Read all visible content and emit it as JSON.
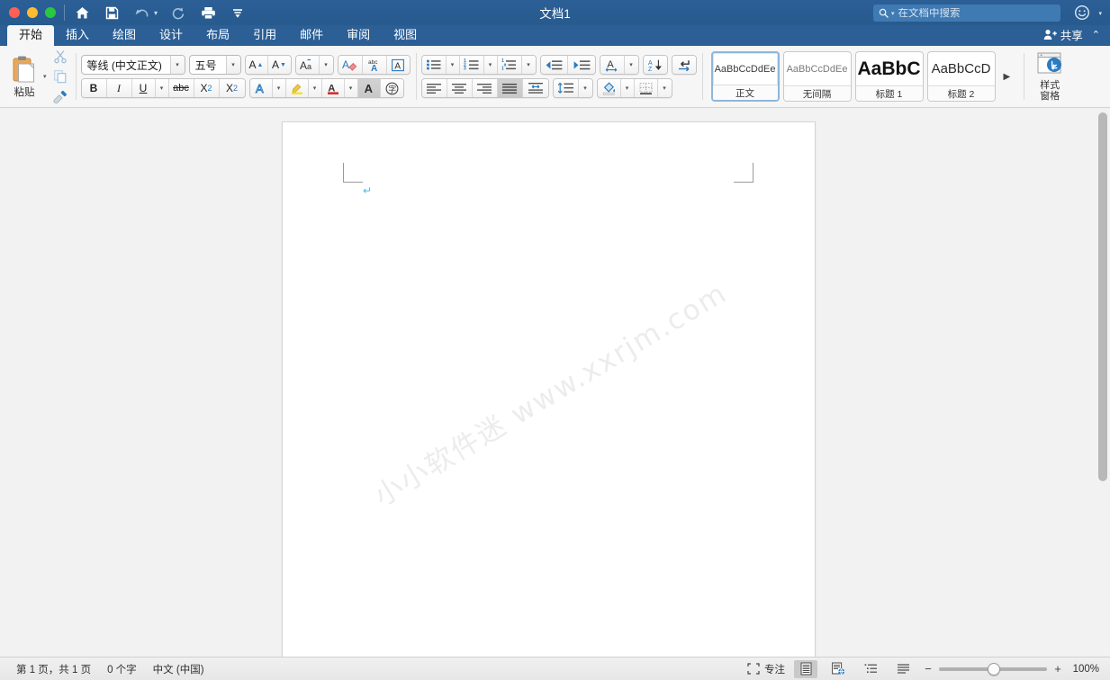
{
  "titlebar": {
    "document_title": "文档1",
    "traffic_lights": [
      "close",
      "minimize",
      "maximize"
    ],
    "quick_access": [
      {
        "name": "home-icon",
        "tooltip": "主页"
      },
      {
        "name": "save-icon",
        "tooltip": "保存"
      },
      {
        "name": "undo-icon",
        "tooltip": "撤消"
      },
      {
        "name": "redo-icon",
        "tooltip": "恢复"
      },
      {
        "name": "print-icon",
        "tooltip": "打印"
      },
      {
        "name": "customize-toolbar-icon",
        "tooltip": "自定义快速访问工具栏"
      }
    ],
    "search_placeholder": "在文档中搜索",
    "search_value": "",
    "account_icon": "smiley-icon"
  },
  "tabs": [
    {
      "label": "开始",
      "active": true
    },
    {
      "label": "插入",
      "active": false
    },
    {
      "label": "绘图",
      "active": false
    },
    {
      "label": "设计",
      "active": false
    },
    {
      "label": "布局",
      "active": false
    },
    {
      "label": "引用",
      "active": false
    },
    {
      "label": "邮件",
      "active": false
    },
    {
      "label": "审阅",
      "active": false
    },
    {
      "label": "视图",
      "active": false
    }
  ],
  "share": {
    "label": "共享",
    "icon": "person-add-icon",
    "collapse_icon": "chevron-up-icon"
  },
  "ribbon": {
    "clipboard": {
      "paste_label": "粘贴",
      "paste_icon": "clipboard-icon",
      "cut_icon": "scissors-icon",
      "copy_icon": "copy-icon",
      "format_painter_icon": "paintbrush-icon"
    },
    "font": {
      "font_name": "等线 (中文正文)",
      "font_size": "五号",
      "grow_font": "A▲",
      "shrink_font": "A▼",
      "change_case": "Aa",
      "clear_formatting_icon": "eraser-icon",
      "phonetic_guide": "abc",
      "character_border": "A",
      "bold": "B",
      "italic": "I",
      "underline": "U",
      "strikethrough": "abc",
      "subscript": "X₂",
      "superscript": "X²",
      "text_effects": "A",
      "highlight": "A",
      "font_color": "A",
      "shading": "A",
      "enclose_characters": "字"
    },
    "paragraph": {
      "bullets_icon": "bullet-list-icon",
      "numbering_icon": "numbered-list-icon",
      "multilevel_icon": "multilevel-list-icon",
      "decrease_indent_icon": "decrease-indent-icon",
      "increase_indent_icon": "increase-indent-icon",
      "text_direction_icon": "text-direction-icon",
      "sort_icon": "sort-az-icon",
      "show_marks_icon": "paragraph-marks-icon",
      "align_left_icon": "align-left-icon",
      "align_center_icon": "align-center-icon",
      "align_right_icon": "align-right-icon",
      "align_justify_icon": "align-justify-icon",
      "distribute_icon": "distributed-icon",
      "line_spacing_icon": "line-spacing-icon",
      "shading_icon": "paint-bucket-icon",
      "borders_icon": "borders-icon",
      "active_alignment": "align-justify-icon"
    },
    "styles": [
      {
        "sample": "AaBbCcDdEe",
        "name": "正文",
        "selected": true,
        "size": 11,
        "weight": "normal"
      },
      {
        "sample": "AaBbCcDdEe",
        "name": "无间隔",
        "selected": false,
        "size": 11,
        "weight": "normal"
      },
      {
        "sample": "AaBbC",
        "name": "标题 1",
        "selected": false,
        "size": 21,
        "weight": "bold"
      },
      {
        "sample": "AaBbCcD",
        "name": "标题 2",
        "selected": false,
        "size": 16,
        "weight": "normal"
      }
    ],
    "styles_more": "▶",
    "styles_pane": {
      "line1": "样式",
      "line2": "窗格",
      "icon": "styles-pane-icon"
    }
  },
  "document": {
    "watermark_text": "小小软件迷 www.xxrjm.com",
    "paragraph_mark": "↵",
    "page_background": "#ffffff",
    "canvas_background": "#f2f2f2"
  },
  "status": {
    "page_info": "第 1 页，共 1 页",
    "word_count": "0 个字",
    "language": "中文 (中国)",
    "focus_label": "专注",
    "focus_icon": "focus-icon",
    "views": [
      {
        "name": "print-layout-view",
        "active": true
      },
      {
        "name": "web-layout-view",
        "active": false
      },
      {
        "name": "outline-view",
        "active": false
      },
      {
        "name": "draft-view",
        "active": false
      }
    ],
    "zoom_out": "−",
    "zoom_in": "+",
    "zoom_level": "100%"
  },
  "colors": {
    "titlebar": "#2b5f96",
    "ribbon_bg": "#f6f6f6",
    "accent_blue": "#2b7bc0",
    "canvas": "#f2f2f2",
    "watermark": "#ececec"
  }
}
